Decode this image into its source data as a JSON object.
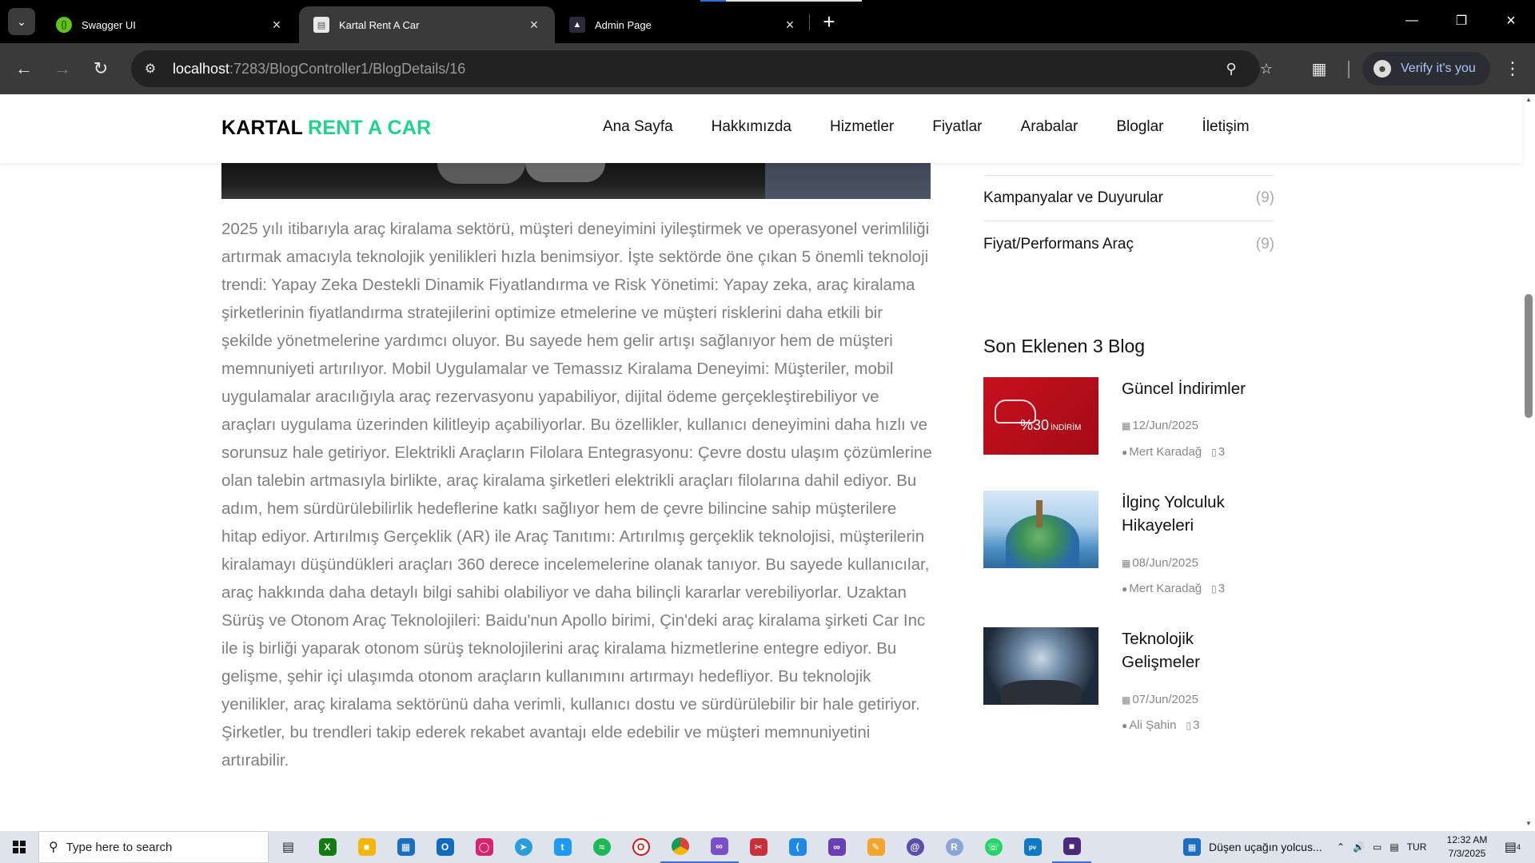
{
  "browser": {
    "tabs": [
      {
        "title": "Swagger UI",
        "active": false
      },
      {
        "title": "Kartal Rent A Car",
        "active": true
      },
      {
        "title": "Admin Page",
        "active": false
      }
    ],
    "new_tab_label": "+",
    "url_host": "localhost",
    "url_path": ":7283/BlogController1/BlogDetails/16",
    "profile_label": "Verify it's you"
  },
  "site": {
    "logo_part1": "KARTAL",
    "logo_part2": "RENT A CAR",
    "logo_accent_color": "#1ed38a",
    "nav": [
      "Ana Sayfa",
      "Hakkımızda",
      "Hizmetler",
      "Fiyatlar",
      "Arabalar",
      "Bloglar",
      "İletişim"
    ]
  },
  "article": {
    "body": "2025 yılı itibarıyla araç kiralama sektörü, müşteri deneyimini iyileştirmek ve operasyonel verimliliği artırmak amacıyla teknolojik yenilikleri hızla benimsiyor. İşte sektörde öne çıkan 5 önemli teknoloji trendi: Yapay Zeka Destekli Dinamik Fiyatlandırma ve Risk Yönetimi: Yapay zeka, araç kiralama şirketlerinin fiyatlandırma stratejilerini optimize etmelerine ve müşteri risklerini daha etkili bir şekilde yönetmelerine yardımcı oluyor. Bu sayede hem gelir artışı sağlanıyor hem de müşteri memnuniyeti artırılıyor. Mobil Uygulamalar ve Temassız Kiralama Deneyimi: Müşteriler, mobil uygulamalar aracılığıyla araç rezervasyonu yapabiliyor, dijital ödeme gerçekleştirebiliyor ve araçları uygulama üzerinden kilitleyip açabiliyorlar. Bu özellikler, kullanıcı deneyimini daha hızlı ve sorunsuz hale getiriyor. Elektrikli Araçların Filolara Entegrasyonu: Çevre dostu ulaşım çözümlerine olan talebin artmasıyla birlikte, araç kiralama şirketleri elektrikli araçları filolarına dahil ediyor. Bu adım, hem sürdürülebilirlik hedeflerine katkı sağlıyor hem de çevre bilincine sahip müşterilere hitap ediyor. Artırılmış Gerçeklik (AR) ile Araç Tanıtımı: Artırılmış gerçeklik teknolojisi, müşterilerin kiralamayı düşündükleri araçları 360 derece incelemelerine olanak tanıyor. Bu sayede kullanıcılar, araç hakkında daha detaylı bilgi sahibi olabiliyor ve daha bilinçli kararlar verebiliyorlar. Uzaktan Sürüş ve Otonom Araç Teknolojileri: Baidu'nun Apollo birimi, Çin'deki araç kiralama şirketi Car Inc ile iş birliği yaparak otonom sürüş teknolojilerini araç kiralama hizmetlerine entegre ediyor. Bu gelişme, şehir içi ulaşımda otonom araçların kullanımını artırmayı hedefliyor. Bu teknolojik yenilikler, araç kiralama sektörünü daha verimli, kullanıcı dostu ve sürdürülebilir bir hale getiriyor. Şirketler, bu trendleri takip ederek rekabet avantajı elde edebilir ve müşteri memnuniyetini artırabilir."
  },
  "sidebar": {
    "categories": [
      {
        "name": "Kampanyalar ve Duyurular",
        "count": "(9)"
      },
      {
        "name": "Fiyat/Performans Araç",
        "count": "(9)"
      }
    ],
    "recent_title": "Son Eklenen 3 Blog",
    "recent_posts": [
      {
        "title": "Güncel İndirimler",
        "date": "12/Jun/2025",
        "author": "Mert Karadağ",
        "comments": "3",
        "thumb": "discount-banner",
        "thumb_text": "%30",
        "thumb_sub": "İNDİRİM"
      },
      {
        "title": "İlginç Yolculuk Hikayeleri",
        "date": "08/Jun/2025",
        "author": "Mert Karadağ",
        "comments": "3",
        "thumb": "travel-globe"
      },
      {
        "title": "Teknolojik Gelişmeler",
        "date": "07/Jun/2025",
        "author": "Ali Şahin",
        "comments": "3",
        "thumb": "tech-hand"
      }
    ]
  },
  "taskbar": {
    "search_placeholder": "Type here to search",
    "news_text": "Düşen uçağın yolcus...",
    "lang": "TUR",
    "time": "12:32 AM",
    "date": "7/3/2025",
    "notification_count": "4"
  }
}
